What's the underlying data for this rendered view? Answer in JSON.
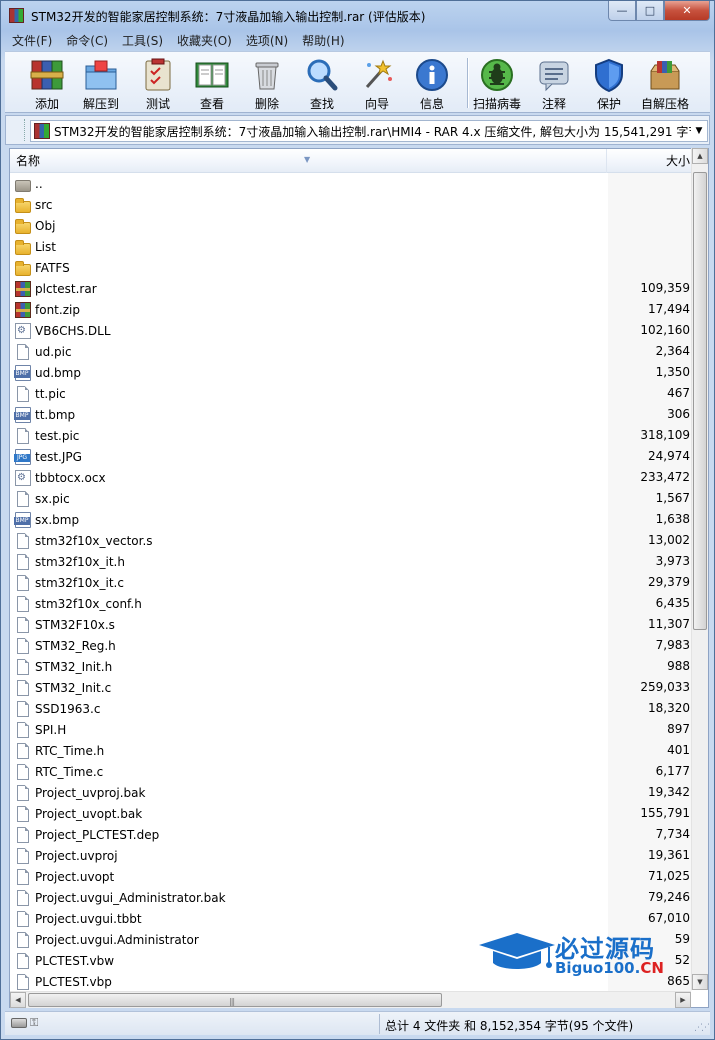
{
  "window": {
    "title": "STM32开发的智能家居控制系统：7寸液晶加输入输出控制.rar (评估版本)",
    "min_label": "—",
    "max_label": "□",
    "close_label": "✕"
  },
  "menu": [
    {
      "label": "文件(F)"
    },
    {
      "label": "命令(C)"
    },
    {
      "label": "工具(S)"
    },
    {
      "label": "收藏夹(O)"
    },
    {
      "label": "选项(N)"
    },
    {
      "label": "帮助(H)"
    }
  ],
  "toolbar": [
    {
      "label": "添加",
      "icon": "add-archive-icon"
    },
    {
      "label": "解压到",
      "icon": "extract-folder-icon"
    },
    {
      "label": "测试",
      "icon": "test-clipboard-icon"
    },
    {
      "label": "查看",
      "icon": "view-book-icon"
    },
    {
      "label": "删除",
      "icon": "trash-icon"
    },
    {
      "label": "查找",
      "icon": "magnifier-icon"
    },
    {
      "label": "向导",
      "icon": "wizard-wand-icon"
    },
    {
      "label": "信息",
      "icon": "info-icon"
    },
    {
      "label": "扫描病毒",
      "icon": "virus-scan-icon"
    },
    {
      "label": "注释",
      "icon": "comment-icon"
    },
    {
      "label": "保护",
      "icon": "shield-icon"
    },
    {
      "label": "自解压格",
      "icon": "sfx-box-icon"
    }
  ],
  "address": {
    "path": "STM32开发的智能家居控制系统：7寸液晶加输入输出控制.rar\\HMI4 - RAR 4.x 压缩文件, 解包大小为 15,541,291 字节"
  },
  "columns": {
    "name": "名称",
    "size": "大小"
  },
  "files": [
    {
      "name": "..",
      "size": "",
      "type": "up"
    },
    {
      "name": "src",
      "size": "",
      "type": "folder"
    },
    {
      "name": "Obj",
      "size": "",
      "type": "folder"
    },
    {
      "name": "List",
      "size": "",
      "type": "folder"
    },
    {
      "name": "FATFS",
      "size": "",
      "type": "folder"
    },
    {
      "name": "plctest.rar",
      "size": "109,359",
      "type": "rar"
    },
    {
      "name": "font.zip",
      "size": "17,494",
      "type": "rar"
    },
    {
      "name": "VB6CHS.DLL",
      "size": "102,160",
      "type": "dll"
    },
    {
      "name": "ud.pic",
      "size": "2,364",
      "type": "file"
    },
    {
      "name": "ud.bmp",
      "size": "1,350",
      "type": "bmp"
    },
    {
      "name": "tt.pic",
      "size": "467",
      "type": "file"
    },
    {
      "name": "tt.bmp",
      "size": "306",
      "type": "bmp"
    },
    {
      "name": "test.pic",
      "size": "318,109",
      "type": "file"
    },
    {
      "name": "test.JPG",
      "size": "24,974",
      "type": "jpg"
    },
    {
      "name": "tbbtocx.ocx",
      "size": "233,472",
      "type": "dll"
    },
    {
      "name": "sx.pic",
      "size": "1,567",
      "type": "file"
    },
    {
      "name": "sx.bmp",
      "size": "1,638",
      "type": "bmp"
    },
    {
      "name": "stm32f10x_vector.s",
      "size": "13,002",
      "type": "file"
    },
    {
      "name": "stm32f10x_it.h",
      "size": "3,973",
      "type": "file"
    },
    {
      "name": "stm32f10x_it.c",
      "size": "29,379",
      "type": "file"
    },
    {
      "name": "stm32f10x_conf.h",
      "size": "6,435",
      "type": "file"
    },
    {
      "name": "STM32F10x.s",
      "size": "11,307",
      "type": "file"
    },
    {
      "name": "STM32_Reg.h",
      "size": "7,983",
      "type": "file"
    },
    {
      "name": "STM32_Init.h",
      "size": "988",
      "type": "file"
    },
    {
      "name": "STM32_Init.c",
      "size": "259,033",
      "type": "file"
    },
    {
      "name": "SSD1963.c",
      "size": "18,320",
      "type": "file"
    },
    {
      "name": "SPI.H",
      "size": "897",
      "type": "file"
    },
    {
      "name": "RTC_Time.h",
      "size": "401",
      "type": "file"
    },
    {
      "name": "RTC_Time.c",
      "size": "6,177",
      "type": "file"
    },
    {
      "name": "Project_uvproj.bak",
      "size": "19,342",
      "type": "file"
    },
    {
      "name": "Project_uvopt.bak",
      "size": "155,791",
      "type": "file"
    },
    {
      "name": "Project_PLCTEST.dep",
      "size": "7,734",
      "type": "file"
    },
    {
      "name": "Project.uvproj",
      "size": "19,361",
      "type": "file"
    },
    {
      "name": "Project.uvopt",
      "size": "71,025",
      "type": "file"
    },
    {
      "name": "Project.uvgui_Administrator.bak",
      "size": "79,246",
      "type": "file"
    },
    {
      "name": "Project.uvgui.tbbt",
      "size": "67,010",
      "type": "file"
    },
    {
      "name": "Project.uvgui.Administrator",
      "size": "59",
      "type": "file"
    },
    {
      "name": "PLCTEST.vbw",
      "size": "52",
      "type": "file"
    },
    {
      "name": "PLCTEST.vbp",
      "size": "865",
      "type": "file"
    }
  ],
  "status": {
    "summary": "总计 4 文件夹 和 8,152,354 字节(95 个文件)"
  },
  "watermark": {
    "title": "必过源码",
    "site_prefix": "Biguo100.",
    "site_suffix": "CN",
    "color": "#1a6fc9"
  }
}
